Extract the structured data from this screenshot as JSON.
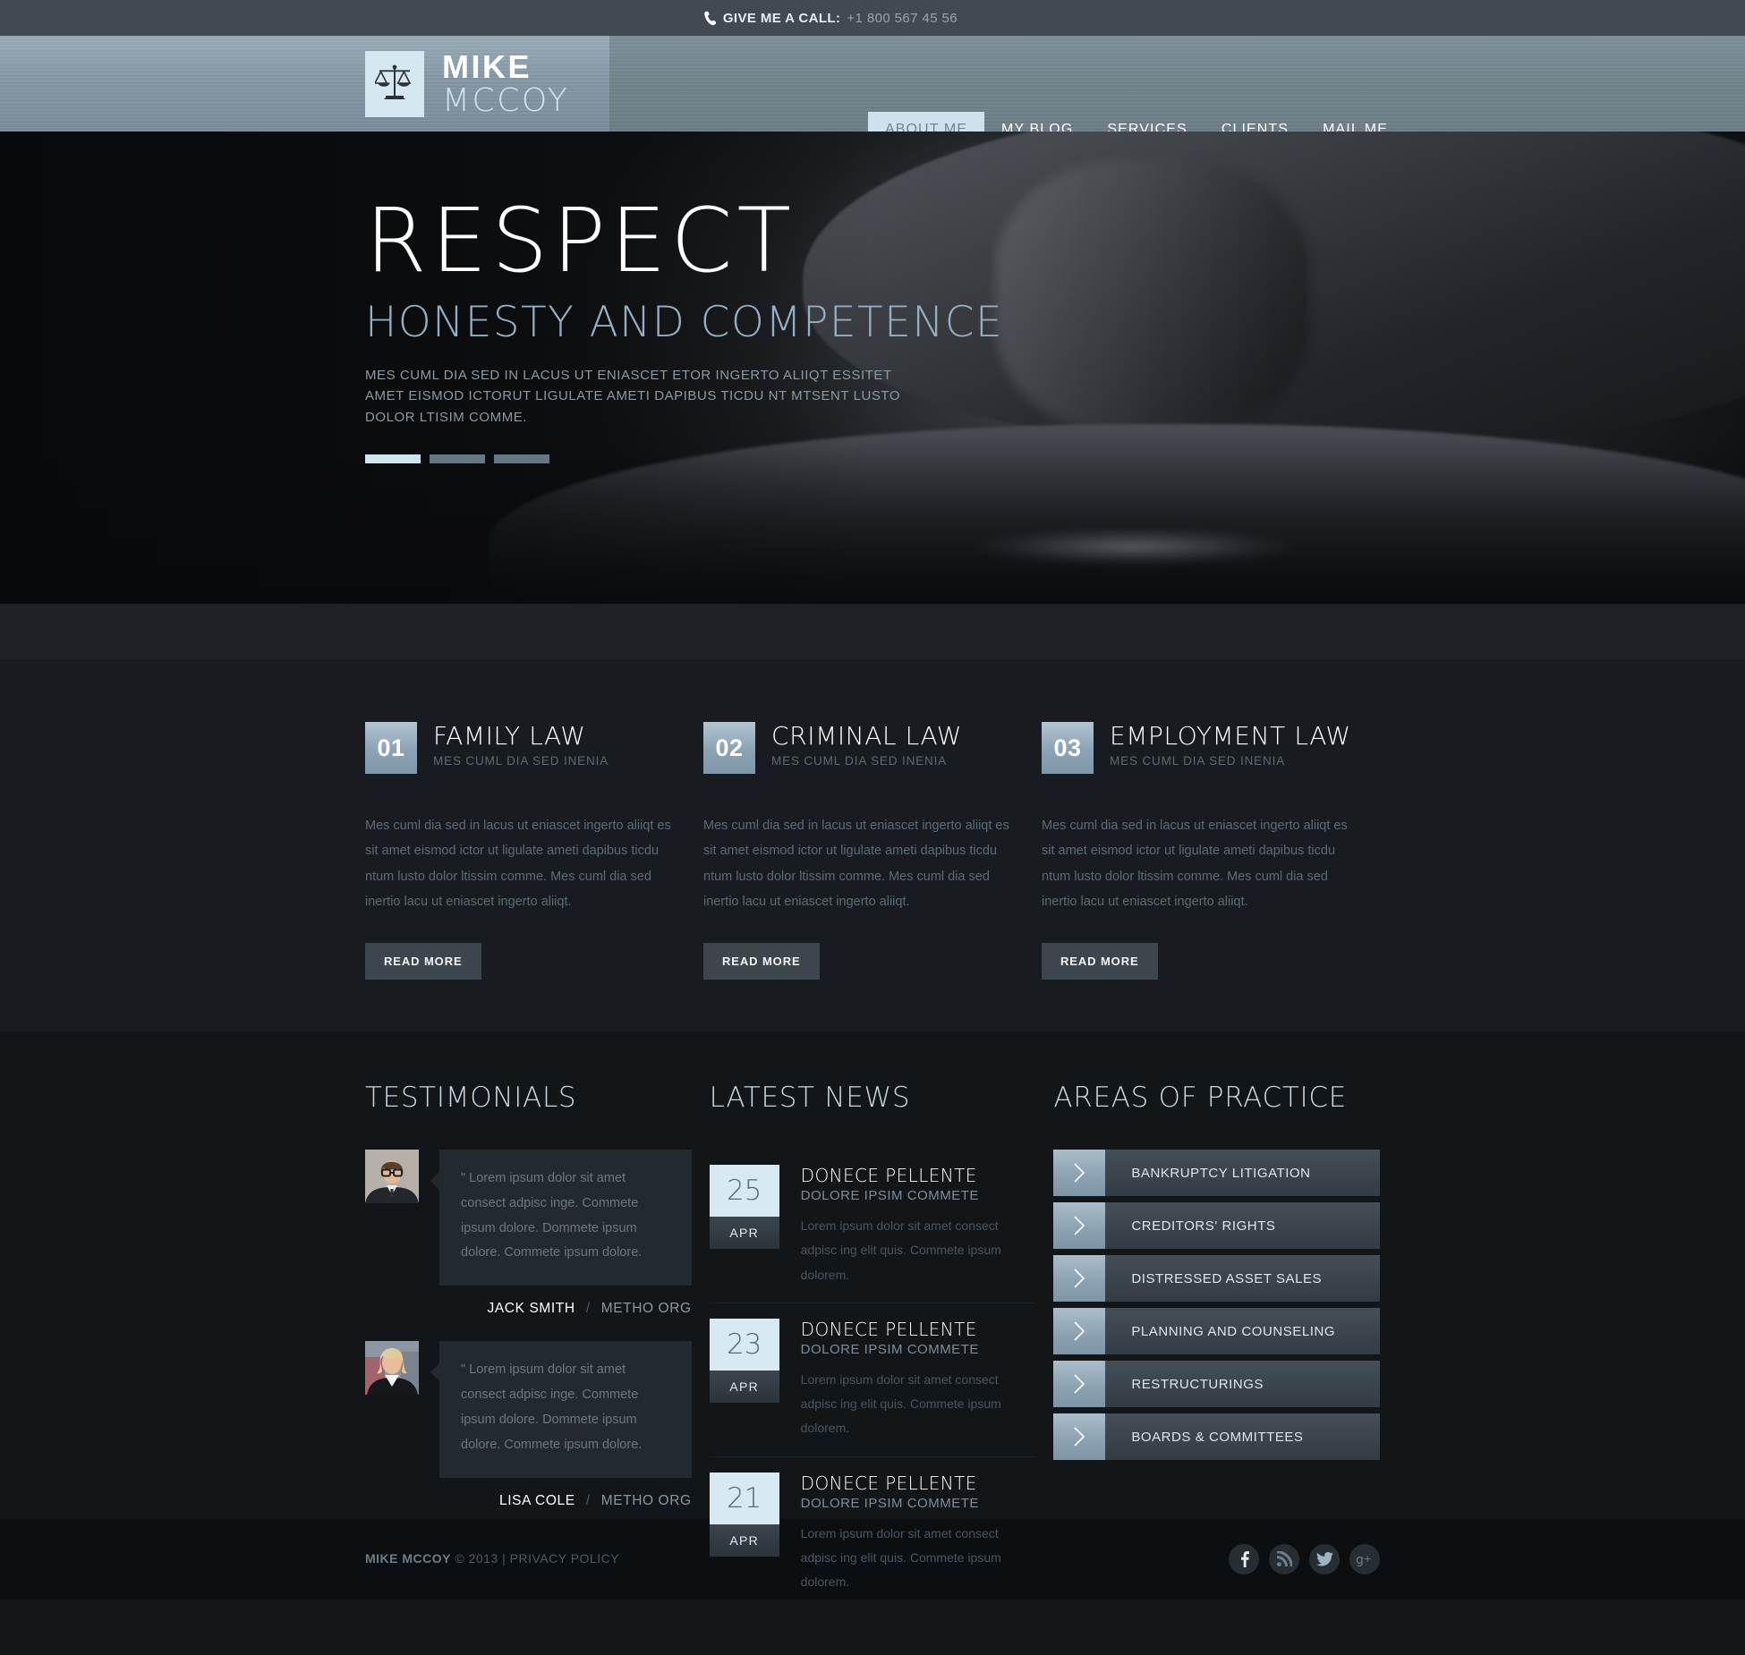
{
  "topbar": {
    "phone_icon": "phone-icon",
    "call_label": "GIVE ME A CALL:",
    "phone_number": "+1 800 567 45 56"
  },
  "header": {
    "logo_icon": "scales-of-justice-icon",
    "logo_first": "MIKE",
    "logo_last": "MCCOY",
    "nav": [
      {
        "label": "ABOUT ME",
        "active": true
      },
      {
        "label": "MY BLOG",
        "active": false
      },
      {
        "label": "SERVICES",
        "active": false
      },
      {
        "label": "CLIENTS",
        "active": false
      },
      {
        "label": "MAIL ME",
        "active": false
      }
    ]
  },
  "hero": {
    "title": "RESPECT",
    "subtitle": "HONESTY AND COMPETENCE",
    "description": "MES CUML DIA SED IN LACUS UT ENIASCET ETOR INGERTO ALIIQT ESSITET AMET EISMOD ICTORUT LIGULATE AMETI DAPIBUS TICDU NT MTSENT LUSTO DOLOR LTISIM COMME.",
    "slides": [
      {
        "active": true
      },
      {
        "active": false
      },
      {
        "active": false
      }
    ]
  },
  "services": {
    "read_more_label": "READ MORE",
    "items": [
      {
        "number": "01",
        "title": "FAMILY LAW",
        "subtitle": "MES CUML DIA SED INENIA",
        "body": "Mes cuml dia sed in lacus ut eniascet ingerto aliiqt es sit amet eismod ictor ut ligulate ameti dapibus ticdu ntum lusto dolor ltissim comme. Mes cuml dia sed inertio lacu ut eniascet ingerto aliiqt."
      },
      {
        "number": "02",
        "title": "CRIMINAL LAW",
        "subtitle": "MES CUML DIA SED INENIA",
        "body": "Mes cuml dia sed in lacus ut eniascet ingerto aliiqt es sit amet eismod ictor ut ligulate ameti dapibus ticdu ntum lusto dolor ltissim comme. Mes cuml dia sed inertio lacu ut eniascet ingerto aliiqt."
      },
      {
        "number": "03",
        "title": "EMPLOYMENT LAW",
        "subtitle": "MES CUML DIA SED INENIA",
        "body": "Mes cuml dia sed in lacus ut eniascet ingerto aliiqt es sit amet eismod ictor ut ligulate ameti dapibus ticdu ntum lusto dolor ltissim comme. Mes cuml dia sed inertio lacu ut eniascet ingerto aliiqt."
      }
    ]
  },
  "testimonials": {
    "title": "TESTIMONIALS",
    "separator": "/",
    "items": [
      {
        "avatar": "avatar-man-glasses",
        "quote": "\" Lorem ipsum dolor sit amet consect adpisc inge. Commete ipsum dolore. Dommete ipsum dolore. Commete ipsum dolore.",
        "name": "JACK SMITH",
        "org": "METHO ORG"
      },
      {
        "avatar": "avatar-woman-blonde",
        "quote": "\" Lorem ipsum dolor sit amet consect adpisc inge. Commete ipsum dolore. Dommete ipsum dolore. Commete ipsum dolore.",
        "name": "LISA COLE",
        "org": "METHO ORG"
      }
    ]
  },
  "news": {
    "title": "LATEST NEWS",
    "items": [
      {
        "day": "25",
        "month": "APR",
        "heading": "DONECE PELLENTE",
        "subheading": "DOLORE IPSIM COMMETE",
        "body": "Lorem ipsum dolor sit amet consect adpisc ing elit quis. Commete ipsum dolorem."
      },
      {
        "day": "23",
        "month": "APR",
        "heading": "DONECE PELLENTE",
        "subheading": "DOLORE IPSIM COMMETE",
        "body": "Lorem ipsum dolor sit amet consect adpisc ing elit quis. Commete ipsum dolorem."
      },
      {
        "day": "21",
        "month": "APR",
        "heading": "DONECE PELLENTE",
        "subheading": "DOLORE IPSIM COMMETE",
        "body": "Lorem ipsum dolor sit amet consect adpisc ing elit quis. Commete ipsum dolorem."
      }
    ]
  },
  "areas": {
    "title": "AREAS OF PRACTICE",
    "chevron_icon": "chevron-right-icon",
    "items": [
      {
        "label": "BANKRUPTCY LITIGATION"
      },
      {
        "label": "CREDITORS' RIGHTS"
      },
      {
        "label": "DISTRESSED ASSET SALES"
      },
      {
        "label": "PLANNING AND COUNSELING"
      },
      {
        "label": "RESTRUCTURINGS"
      },
      {
        "label": "BOARDS & COMMITTEES"
      }
    ]
  },
  "footer": {
    "brand": "MIKE MCCOY",
    "copyright": " © 2013 | PRIVACY POLICY",
    "socials": [
      {
        "icon": "facebook-icon"
      },
      {
        "icon": "rss-icon"
      },
      {
        "icon": "twitter-icon"
      },
      {
        "icon": "google-plus-icon"
      }
    ]
  },
  "colors": {
    "accent_light": "#cde2ed",
    "accent_blue": "#8ba3b4",
    "header_bg": "#7e919e",
    "topbar_bg": "#414a52",
    "body_bg": "#181c20",
    "lower_bg": "#121619"
  }
}
